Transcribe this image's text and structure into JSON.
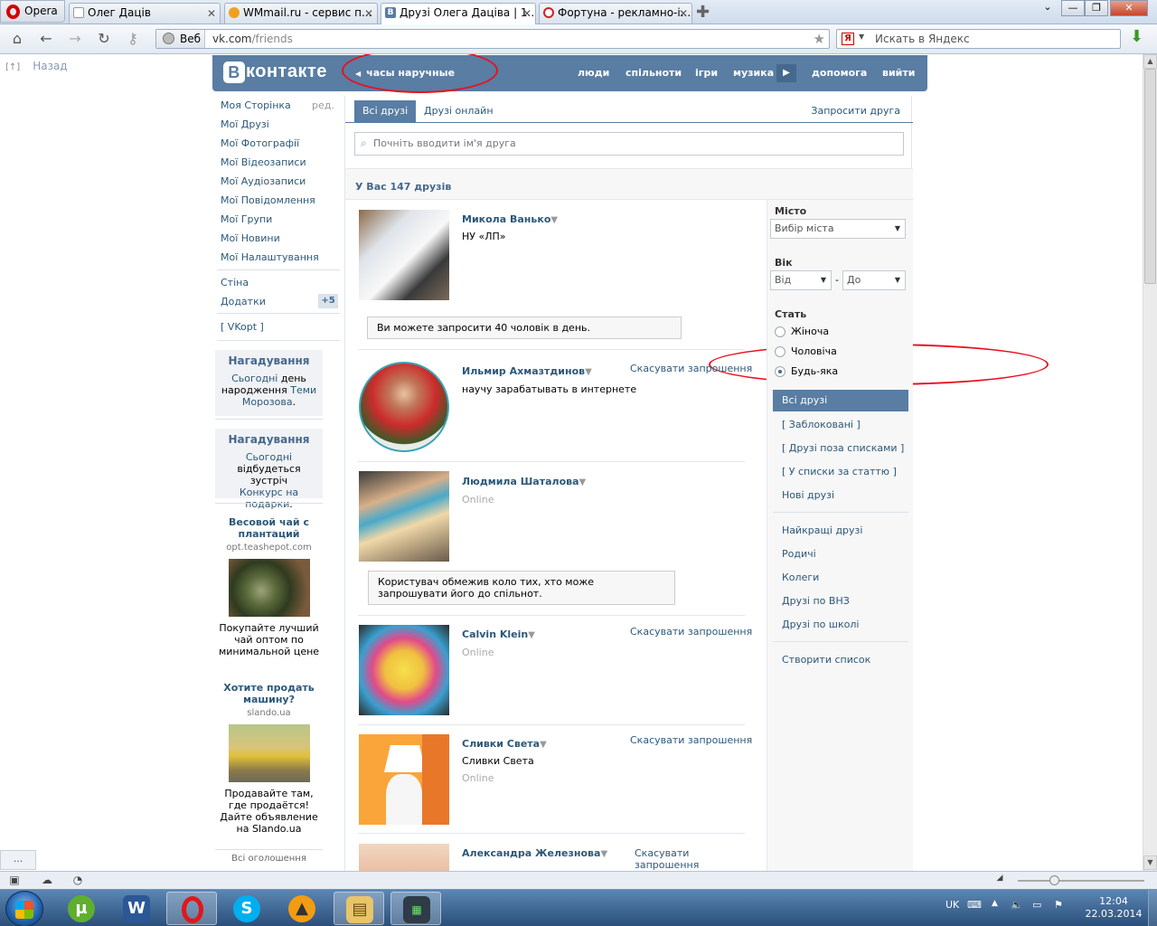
{
  "browser": {
    "menu_label": "Opera",
    "tabs": [
      {
        "title": "Олег Даців"
      },
      {
        "title": "WMmail.ru - сервис п..."
      },
      {
        "title": "Друзі Олега Дацівa | 1..."
      },
      {
        "title": "Фортуна - рекламно-і..."
      }
    ],
    "web_label": "Веб",
    "url_host": "vk.com",
    "url_path": "/friends",
    "search_placeholder": "Искать в Яндекс",
    "back_page_label": "Назад",
    "back_page_marker": "[↑]"
  },
  "vk": {
    "logo_text": "контакте",
    "logo_letter": "В",
    "status_text": "часы наручные",
    "top_nav": [
      "люди",
      "спільноти",
      "ігри",
      "музика",
      "допомога",
      "вийти"
    ]
  },
  "left_menu": {
    "items": [
      "Моя Сторінка",
      "Мої Друзі",
      "Мої Фотографії",
      "Мої Відеозаписи",
      "Мої Аудіозаписи",
      "Мої Повідомлення",
      "Мої Групи",
      "Мої Новини",
      "Мої Налаштування"
    ],
    "edit_label": "ред.",
    "extra_items": [
      "Стіна",
      "Додатки"
    ],
    "apps_badge": "+5",
    "vkopt": "[ VKopt ]",
    "reminders": [
      {
        "title": "Нагадування",
        "line1_link": "Сьогодні",
        "line1_rest": " день",
        "line2_text": "народження ",
        "line2_link": "Теми",
        "line3_link": "Морозова",
        "line3_rest": "."
      },
      {
        "title": "Нагадування",
        "line1_link": "Сьогодні",
        "line2_text": "відбудеться зустріч",
        "line3_link": "Конкурс на подарки",
        "line3_rest": "."
      }
    ],
    "ads": [
      {
        "title": "Весовой чай с плантаций",
        "domain": "opt.teashepot.com",
        "text": "Покупайте лучший чай оптом по минимальной цене"
      },
      {
        "title": "Хотите продать машину?",
        "domain": "slando.ua",
        "text": "Продавайте там, где продаётся! Дайте объявление на Slando.ua"
      }
    ],
    "all_ads": "Всі оголошення"
  },
  "friends": {
    "tab_all": "Всі друзі",
    "tab_online": "Друзі онлайн",
    "invite_link": "Запросити друга",
    "search_placeholder": "Почніть вводити ім'я друга",
    "count_text": "У Вас 147 друзів",
    "dropdown_marker": "▼",
    "list": [
      {
        "name": "Микола Ванько",
        "sub": "НУ «ЛП»"
      },
      {
        "name": "Ильмир Ахмaзтдинов",
        "sub": "научу зарабатывать в интернете",
        "action": "Скасувати запрошення"
      },
      {
        "name": "Людмила Шаталова",
        "status": "Online"
      },
      {
        "name": "Calvin Klein",
        "status": "Online",
        "action": "Скасувати запрошення"
      },
      {
        "name": "Сливки Света",
        "sub": "Сливки Света",
        "status": "Online",
        "action": "Скасувати запрошення"
      },
      {
        "name": "Александра Железнова",
        "action": "Скасувати запрошення"
      }
    ],
    "note_limit": "Ви можете запросити 40 чоловік в день.",
    "note_restricted": "Користувач обмежив коло тих, хто може запрошувати його до спільнот."
  },
  "filters": {
    "city_label": "Місто",
    "city_select": "Вибір міста",
    "age_label": "Вік",
    "age_from": "Від",
    "age_dash": "-",
    "age_to": "До",
    "sex_label": "Стать",
    "sex_options": [
      "Жіноча",
      "Чоловіча",
      "Будь-яка"
    ],
    "sex_selected": "Будь-яка",
    "lists_selected": "Всі друзі",
    "lists": [
      "[ Заблоковані ]",
      "[ Друзі поза списками ]",
      "[ У списки за статтю ]",
      "Нові друзі"
    ],
    "groups": [
      "Найкращі друзі",
      "Родичі",
      "Колеги",
      "Друзі по ВНЗ",
      "Друзі по школі"
    ],
    "create_list": "Створити список"
  },
  "statusbar": {
    "ellipsis": "..."
  },
  "taskbar": {
    "lang": "UK",
    "time": "12:04",
    "date": "22.03.2014",
    "apps": [
      "utorrent",
      "word",
      "opera",
      "skype",
      "aimp",
      "explorer",
      "monitor"
    ]
  },
  "colors": {
    "vk_blue": "#597da3",
    "link": "#2b587a",
    "annotation_red": "#e8101e"
  }
}
